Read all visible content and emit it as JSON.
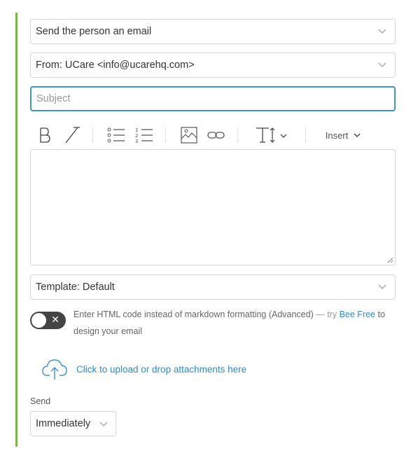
{
  "action_select": {
    "value": "Send the person an email"
  },
  "from_select": {
    "value": "From: UCare <info@ucarehq.com>"
  },
  "subject": {
    "placeholder": "Subject",
    "value": ""
  },
  "toolbar": {
    "bold_icon": "bold-icon",
    "italic_icon": "italic-icon",
    "insert_label": "Insert"
  },
  "template_select": {
    "value": "Template: Default"
  },
  "html_toggle": {
    "enabled": false,
    "text": "Enter HTML code instead of markdown formatting (Advanced)",
    "dash_try": "— try",
    "link": "Bee Free",
    "suffix": "to design your email"
  },
  "upload": {
    "label": "Click to upload or drop attachments here"
  },
  "send": {
    "label": "Send",
    "value": "Immediately"
  },
  "colors": {
    "accent_bar": "#7ab648",
    "focus": "#3a93d2",
    "link": "#2a8bd0",
    "toggle_bg": "#444444"
  }
}
